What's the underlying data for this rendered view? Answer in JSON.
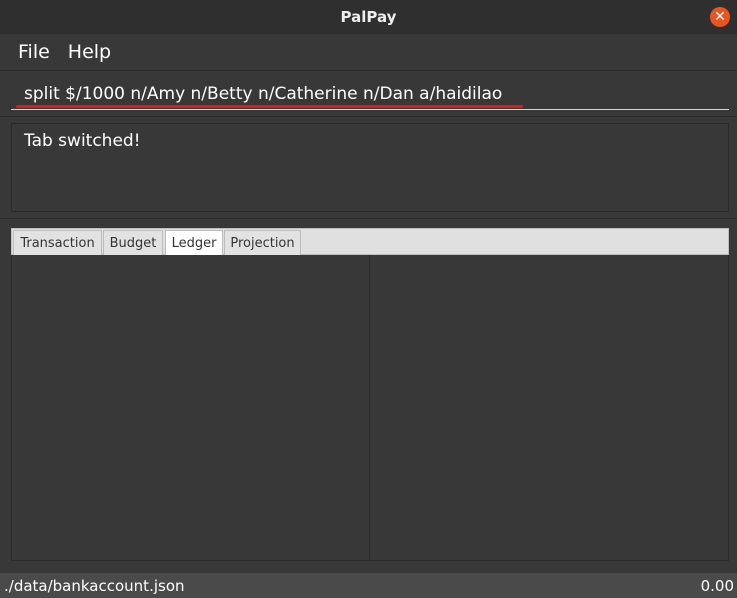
{
  "window": {
    "title": "PalPay",
    "close_glyph": "✕"
  },
  "menu": {
    "items": [
      {
        "label": "File"
      },
      {
        "label": "Help"
      }
    ]
  },
  "command_box": {
    "value": "split $/1000 n/Amy n/Betty n/Catherine n/Dan a/haidilao"
  },
  "result_display": {
    "text": "Tab switched!"
  },
  "tabs": {
    "items": [
      {
        "label": "Transaction"
      },
      {
        "label": "Budget"
      },
      {
        "label": "Ledger"
      },
      {
        "label": "Projection"
      }
    ],
    "selected": "Ledger"
  },
  "status_bar": {
    "file_path": "./data/bankaccount.json",
    "balance": "0.00"
  },
  "colors": {
    "background": "#383838",
    "accent_close": "#e95420",
    "spell_error": "#e01b1b"
  }
}
